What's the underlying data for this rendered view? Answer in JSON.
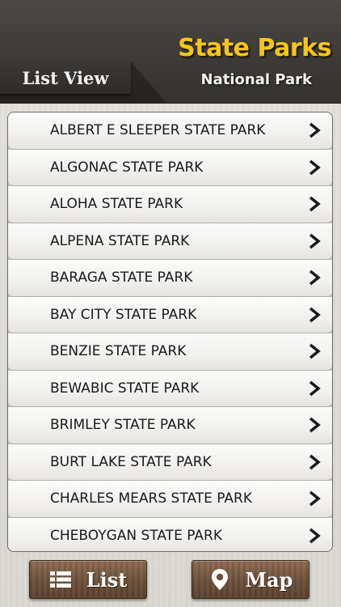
{
  "header": {
    "tab_label": "List View",
    "title": "State Parks",
    "subtitle": "National Park"
  },
  "colors": {
    "title_accent": "#f6c612",
    "header_bg": "#3c3936",
    "button_brown": "#6c4f39"
  },
  "list": {
    "items": [
      "ALBERT E SLEEPER STATE PARK",
      "ALGONAC STATE PARK",
      "ALOHA STATE PARK",
      "ALPENA STATE PARK",
      "BARAGA STATE PARK",
      "BAY CITY STATE PARK",
      "BENZIE STATE PARK",
      "BEWABIC STATE PARK",
      "BRIMLEY STATE PARK",
      "BURT LAKE STATE PARK",
      "CHARLES MEARS STATE PARK",
      "CHEBOYGAN STATE PARK"
    ],
    "item_icon": "chevron-right-icon"
  },
  "bottom_bar": {
    "list_label": "List",
    "list_icon": "list-icon",
    "map_label": "Map",
    "map_icon": "map-pin-icon"
  }
}
